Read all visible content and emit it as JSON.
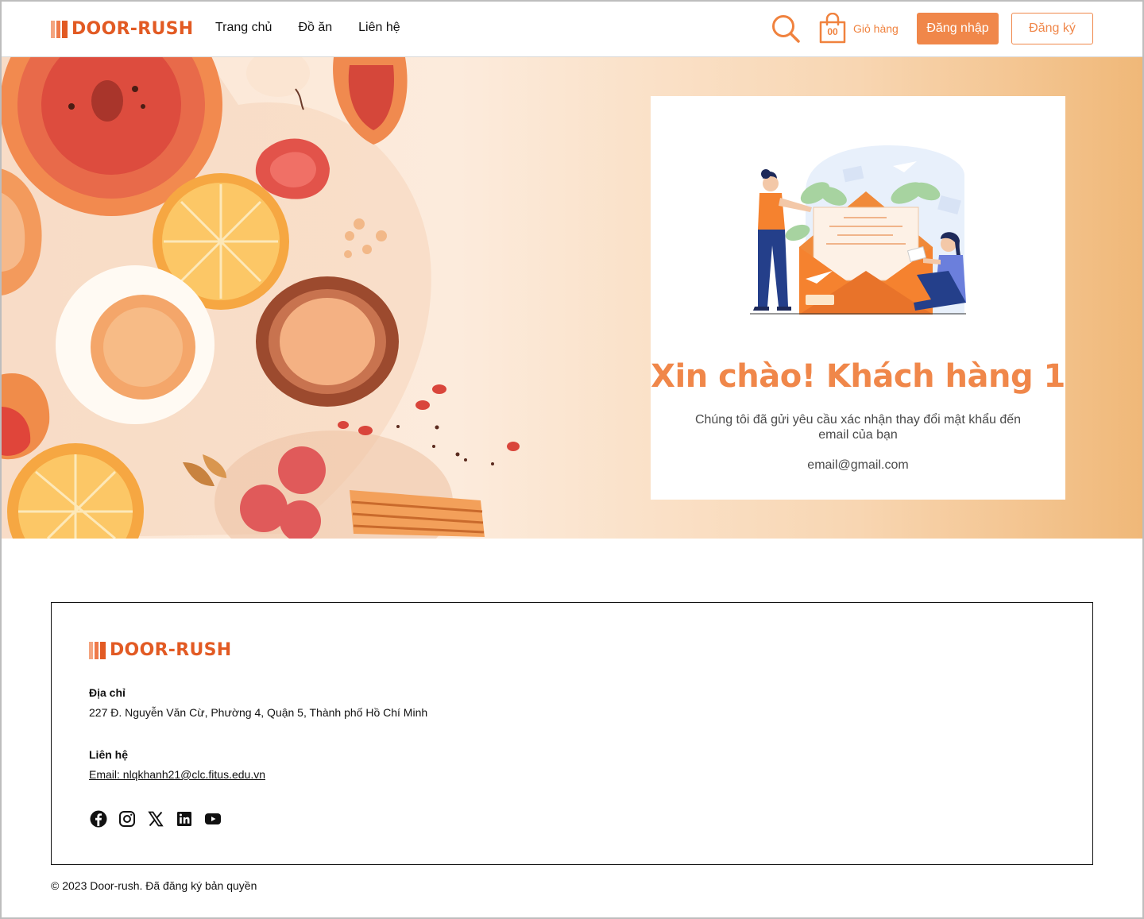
{
  "brand": {
    "name": "DOOR-RUSH"
  },
  "nav": {
    "items": [
      "Trang chủ",
      "Đồ ăn",
      "Liên hệ"
    ]
  },
  "header": {
    "cart_count": "00",
    "cart_label": "Giỏ hàng",
    "login_label": "Đăng nhập",
    "register_label": "Đăng ký"
  },
  "card": {
    "title": "Xin chào! Khách hàng 1",
    "message": "Chúng tôi đã gửi yêu cầu xác nhận thay đổi mật khẩu đến email của bạn",
    "email": "email@gmail.com"
  },
  "footer": {
    "address_label": "Địa chỉ",
    "address": "227 Đ. Nguyễn Văn Cừ, Phường 4, Quận 5, Thành phố Hồ Chí Minh",
    "contact_label": "Liên hệ",
    "contact_email": "Email: nlqkhanh21@clc.fitus.edu.vn",
    "socials": [
      "facebook-icon",
      "instagram-icon",
      "x-icon",
      "linkedin-icon",
      "youtube-icon"
    ],
    "copyright": "© 2023 Door-rush. Đã đăng ký bản quyền"
  },
  "colors": {
    "accent": "#f0874a",
    "brand": "#e25a23"
  }
}
